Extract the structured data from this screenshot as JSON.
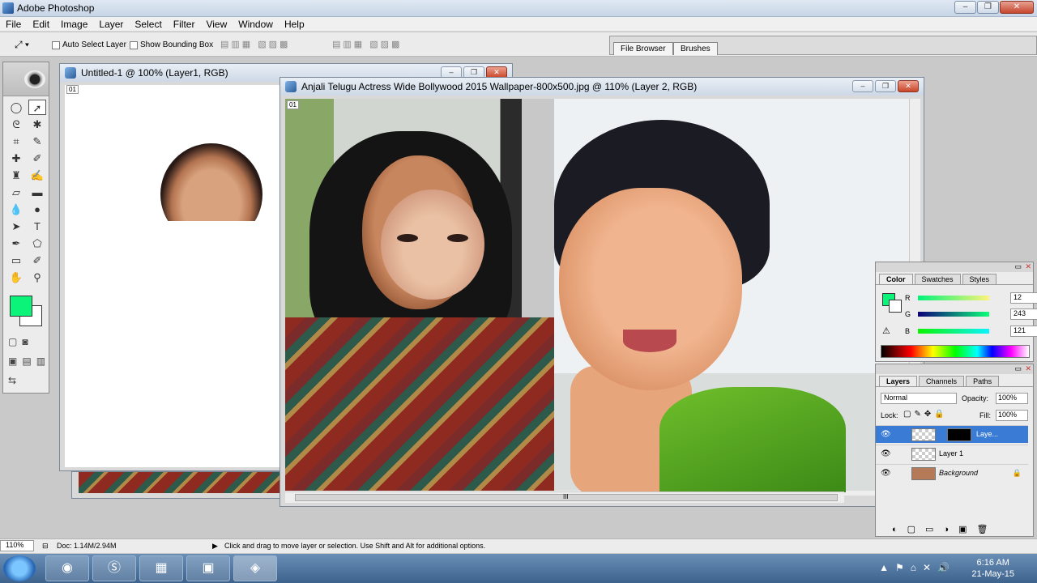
{
  "app": {
    "title": "Adobe Photoshop"
  },
  "menu": [
    "File",
    "Edit",
    "Image",
    "Layer",
    "Select",
    "Filter",
    "View",
    "Window",
    "Help"
  ],
  "options": {
    "auto_select_label": "Auto Select Layer",
    "bounding_box_label": "Show Bounding Box",
    "palette_well_tabs": [
      "File Browser",
      "Brushes"
    ]
  },
  "tools": {
    "foreground_color": "#0cf379",
    "background_color": "#ffffff"
  },
  "documents": {
    "untitled": {
      "title": "Untitled-1 @ 100% (Layer1, RGB)",
      "pct": "01"
    },
    "main": {
      "title": "Anjali Telugu Actress Wide Bollywood 2015 Wallpaper-800x500.jpg @ 110% (Layer 2, RGB)",
      "pct": "01",
      "scroll_mark": "III"
    }
  },
  "color_panel": {
    "tabs": [
      "Color",
      "Swatches",
      "Styles"
    ],
    "r_label": "R",
    "g_label": "G",
    "b_label": "B",
    "r": "12",
    "g": "243",
    "b": "121"
  },
  "layers_panel": {
    "tabs": [
      "Layers",
      "Channels",
      "Paths"
    ],
    "blend_mode": "Normal",
    "opacity_label": "Opacity:",
    "opacity": "100%",
    "lock_label": "Lock:",
    "fill_label": "Fill:",
    "fill": "100%",
    "layers": [
      {
        "name": "Laye..."
      },
      {
        "name": "Layer 1"
      },
      {
        "name": "Background"
      }
    ]
  },
  "status": {
    "zoom": "110%",
    "doc": "Doc: 1.14M/2.94M",
    "hint": "Click and drag to move layer or selection.  Use Shift and Alt for additional options."
  },
  "taskbar": {
    "time": "6:16 AM",
    "date": "21-May-15"
  }
}
